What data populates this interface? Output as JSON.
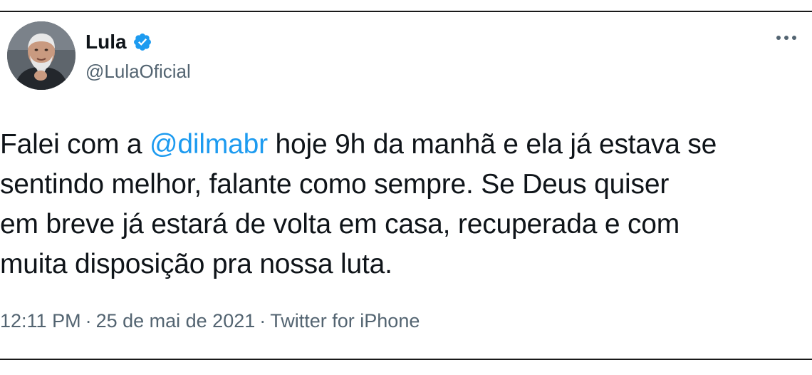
{
  "tweet": {
    "author": {
      "name": "Lula",
      "handle": "@LulaOficial",
      "verified": true
    },
    "text": {
      "line1_before": "Falei com a ",
      "mention": "@dilmabr",
      "line1_after": " hoje 9h da manhã e ela já estava se",
      "line2": "sentindo melhor, falante como sempre. Se Deus quiser",
      "line3": "em breve já estará de volta em casa, recuperada e com",
      "line4": "muita disposição pra nossa luta."
    },
    "meta": {
      "time": "12:11 PM",
      "separator": "·",
      "date": "25 de mai de 2021",
      "source": "Twitter for iPhone"
    }
  },
  "icons": {
    "verified": "verified-badge-icon",
    "more": "more-options-icon"
  },
  "colors": {
    "accent": "#1d9bf0",
    "text": "#0f1419",
    "secondary": "#536471",
    "border": "#1a1a1a"
  }
}
